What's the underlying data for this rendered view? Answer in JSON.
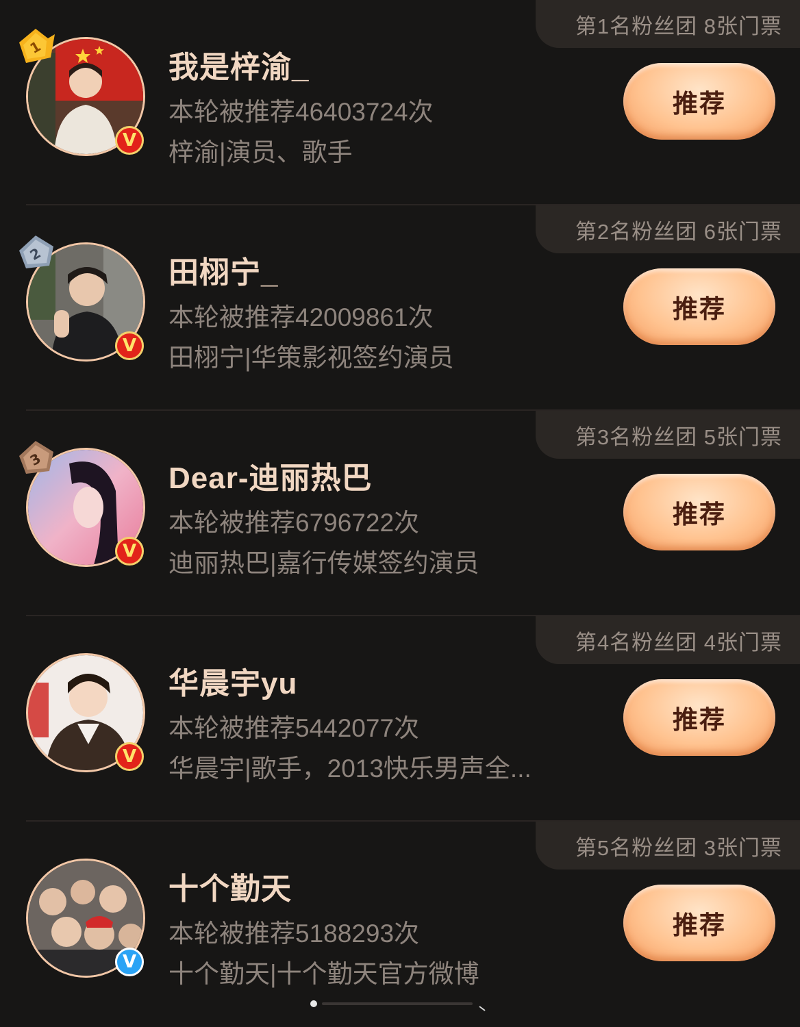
{
  "rows": [
    {
      "rank": "1",
      "fan_tag": "第1名粉丝团 8张门票",
      "name": "我是梓渝_",
      "count": "本轮被推荐46403724次",
      "desc": "梓渝|演员、歌手",
      "button": "推荐",
      "verify": "V",
      "medal_color": "#f6b21c"
    },
    {
      "rank": "2",
      "fan_tag": "第2名粉丝团 6张门票",
      "name": "田栩宁_",
      "count": "本轮被推荐42009861次",
      "desc": "田栩宁|华策影视签约演员",
      "button": "推荐",
      "verify": "V",
      "medal_color": "#aab6c6"
    },
    {
      "rank": "3",
      "fan_tag": "第3名粉丝团 5张门票",
      "name": "Dear-迪丽热巴",
      "count": "本轮被推荐6796722次",
      "desc": "迪丽热巴|嘉行传媒签约演员",
      "button": "推荐",
      "verify": "V",
      "medal_color": "#c79a7a"
    },
    {
      "fan_tag": "第4名粉丝团 4张门票",
      "name": "华晨宇yu",
      "count": "本轮被推荐5442077次",
      "desc": "华晨宇|歌手，2013快乐男声全...",
      "button": "推荐",
      "verify": "V"
    },
    {
      "fan_tag": "第5名粉丝团 3张门票",
      "name": "十个勤天",
      "count": "本轮被推荐5188293次",
      "desc": "十个勤天|十个勤天官方微博",
      "button": "推荐",
      "verify": "V"
    }
  ]
}
